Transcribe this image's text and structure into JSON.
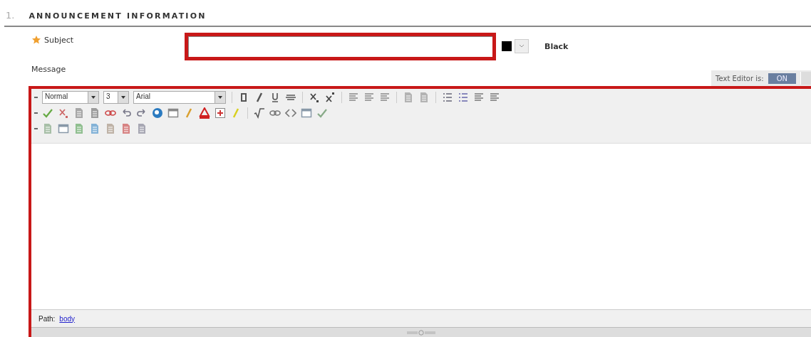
{
  "section": {
    "number": "1.",
    "title": "ANNOUNCEMENT INFORMATION"
  },
  "subject": {
    "label": "Subject",
    "required": true
  },
  "color_picker": {
    "label": "Black"
  },
  "message": {
    "label": "Message"
  },
  "text_editor_toggle": {
    "label": "Text Editor is:",
    "button": "ON",
    "on": true
  },
  "toolbar": {
    "format": "Normal",
    "size": "3",
    "font": "Arial"
  },
  "path_bar": {
    "label": "Path:",
    "link": "body"
  }
}
